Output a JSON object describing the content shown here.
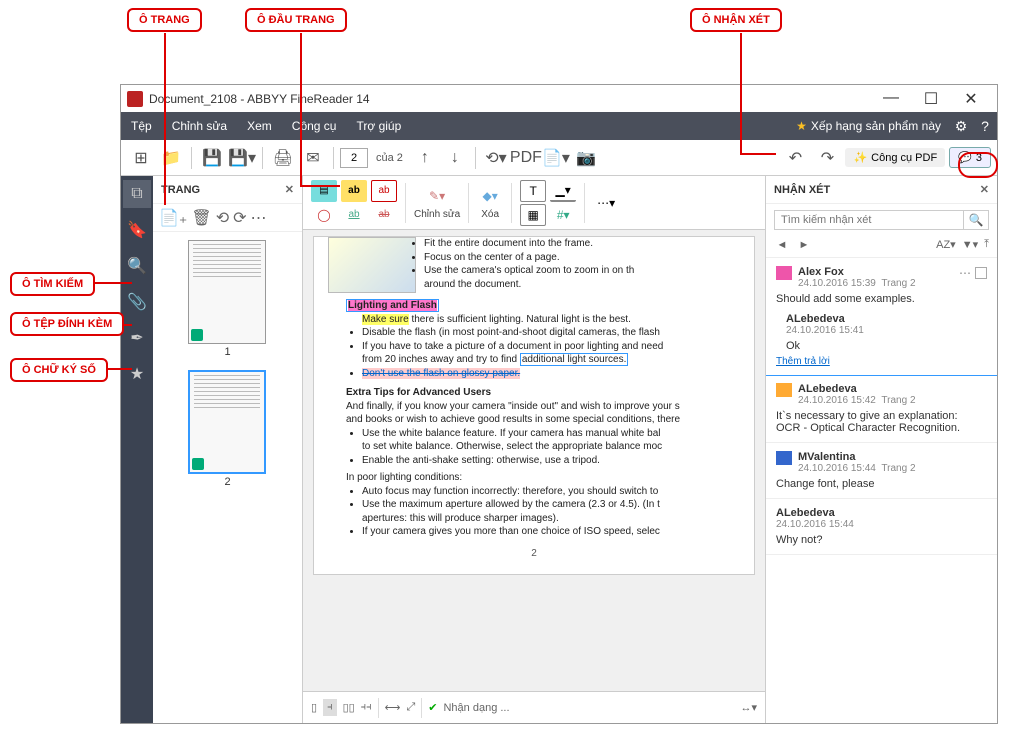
{
  "callouts": {
    "page_pane": "Ô TRANG",
    "page_header": "Ô ĐẦU TRANG",
    "comments_pane": "Ô NHẬN XÉT",
    "search_pane": "Ô TÌM KIẾM",
    "attachments_pane": "Ô TỆP\nĐÍNH KÈM",
    "signature_pane": "Ô CHỮ KÝ SỐ"
  },
  "window": {
    "title": "Document_2108 - ABBYY FineReader 14"
  },
  "menubar": {
    "file": "Tệp",
    "edit": "Chỉnh sửa",
    "view": "Xem",
    "tools": "Công cụ",
    "help": "Trợ giúp",
    "rate": "Xếp hạng sản phẩm này"
  },
  "toolbar": {
    "page_value": "2",
    "page_of": "của 2",
    "pdf_tools": "Công cụ PDF",
    "comment_count": "3"
  },
  "pages_panel": {
    "title": "TRANG",
    "thumb1": "1",
    "thumb2": "2"
  },
  "markup": {
    "edit": "Chỉnh sửa",
    "delete": "Xóa",
    "ab": "ab"
  },
  "doc": {
    "bullets1": {
      "b1": "Fit the entire document into the frame.",
      "b2": "Focus on the center of a page.",
      "b3a": "Use the camera's optical zoom to zoom in on th",
      "b3b": "around the document."
    },
    "h_lighting": "Lighting and Flash",
    "make_sure": "Make sure",
    "make_sure_rest": " there is sufficient lighting. Natural light is the best.",
    "bullets2": {
      "b1": "Disable the flash (in most point-and-shoot digital cameras, the flash",
      "b2a": "If you have to take a picture of a document in poor lighting and need",
      "b2b": "from 20 inches away and try to find ",
      "b2c": "additional light sources.",
      "b3": "Don't use the flash on glossy paper."
    },
    "h_extra": "Extra Tips for Advanced Users",
    "p_extra_a": "And finally, if you know your camera \"inside out\" and wish to improve your s",
    "p_extra_b": "and books or wish to achieve good results in some special conditions, there",
    "bullets3": {
      "b1a": "Use the white balance feature. If your camera has manual white bal",
      "b1b": "to set white balance. Otherwise, select the appropriate balance moc",
      "b2": "Enable the anti-shake setting: otherwise, use a tripod."
    },
    "p_poor": "In poor lighting conditions:",
    "bullets4": {
      "b1": "Auto focus may function incorrectly: therefore, you should switch to",
      "b2a": "Use the maximum aperture allowed by the camera (2.3 or 4.5). (In t",
      "b2b": "apertures: this will produce sharper images).",
      "b3": "If your camera gives you more than one choice of ISO speed, selec"
    },
    "page_number": "2"
  },
  "footer": {
    "recognize": "Nhận dạng ..."
  },
  "comments_panel": {
    "title": "NHẬN XÉT",
    "search_placeholder": "Tìm kiếm nhận xét",
    "sort": "AZ",
    "c1": {
      "author": "Alex Fox",
      "meta_time": "24.10.2016 15:39",
      "meta_page": "Trang 2",
      "body": "Should add some examples.",
      "reply_author": "ALebedeva",
      "reply_time": "24.10.2016 15:41",
      "reply_body": "Ok",
      "reply_link": "Thêm trả lời"
    },
    "c2": {
      "author": "ALebedeva",
      "meta_time": "24.10.2016 15:42",
      "meta_page": "Trang 2",
      "body_a": "It`s necessary to give an explanation:",
      "body_b": "OCR - Optical Character Recognition."
    },
    "c3": {
      "author": "MValentina",
      "meta_time": "24.10.2016 15:44",
      "meta_page": "Trang 2",
      "body": "Change font, please"
    },
    "c4": {
      "author": "ALebedeva",
      "meta_time": "24.10.2016 15:44",
      "body": "Why not?"
    }
  }
}
